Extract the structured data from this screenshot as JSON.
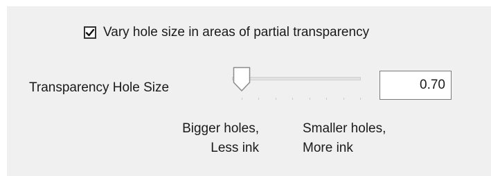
{
  "checkbox": {
    "checked": true,
    "label": "Vary hole size in areas of partial transparency"
  },
  "slider": {
    "label": "Transparency Hole Size",
    "value": "0.70",
    "level_fraction": 0.0,
    "left_caption_line1": "Bigger holes,",
    "left_caption_line2": "Less ink",
    "right_caption_line1": "Smaller holes,",
    "right_caption_line2": "More ink"
  },
  "colors": {
    "panel_bg": "#f0f0f0",
    "text": "#1a1a1a"
  },
  "icons": {
    "checkmark": "check-icon",
    "slider_thumb": "slider-thumb-icon"
  }
}
